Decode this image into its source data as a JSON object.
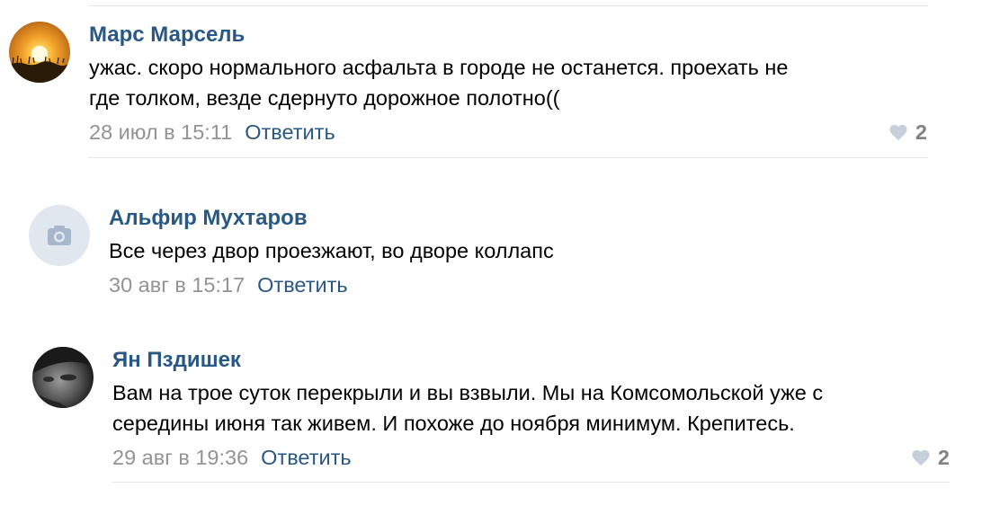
{
  "comments": [
    {
      "author": "Марс Марсель",
      "text_lines": [
        "ужас. скоро нормального асфальта в городе не останется. проехать не",
        "где толком, везде сдернуто дорожное полотно(("
      ],
      "date": "28 июл в 15:11",
      "reply_label": "Ответить",
      "likes": "2",
      "avatar": "sunset-photo"
    },
    {
      "author": "Альфир Мухтаров",
      "text_lines": [
        "Все через двор проезжают, во дворе коллапс"
      ],
      "date": "30 авг в 15:17",
      "reply_label": "Ответить",
      "avatar": "camera-icon"
    },
    {
      "author": "Ян Пздишек",
      "text_lines": [
        "Вам на трое суток перекрыли и вы взвыли. Мы на Комсомольской уже с",
        "середины июня так живем. И похоже до ноября минимум. Крепитесь."
      ],
      "date": "29 авг в 19:36",
      "reply_label": "Ответить",
      "likes": "2",
      "avatar": "face-photo"
    }
  ],
  "colors": {
    "author": "#2a5885",
    "date": "#939393",
    "likes": "#828282",
    "divider": "#e7e8ec"
  }
}
